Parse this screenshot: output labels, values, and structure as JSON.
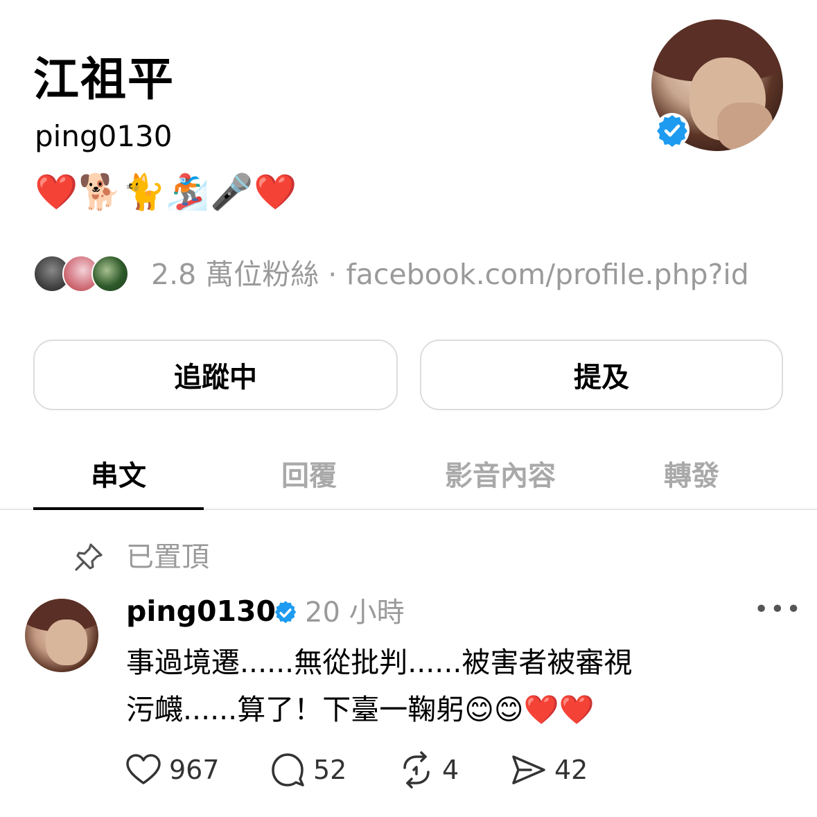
{
  "profile": {
    "display_name": "江祖平",
    "username": "ping0130",
    "bio_emojis": [
      "❤️",
      "🐕",
      "🐈",
      "🏂",
      "🎤",
      "❤️"
    ],
    "followers_text": "2.8 萬位粉絲 · facebook.com/profile.php?id"
  },
  "buttons": {
    "following_label": "追蹤中",
    "mention_label": "提及"
  },
  "tabs": [
    {
      "label": "串文",
      "active": true
    },
    {
      "label": "回覆",
      "active": false
    },
    {
      "label": "影音內容",
      "active": false
    },
    {
      "label": "轉發",
      "active": false
    }
  ],
  "pinned": {
    "label": "已置頂"
  },
  "post": {
    "username": "ping0130",
    "time": "20 小時",
    "more_label": "•••",
    "line1": "事過境遷......無從批判......被害者被審視",
    "line2": "污衊......算了！下臺一鞠躬😊😊❤️❤️",
    "likes": "967",
    "comments": "52",
    "reposts": "4",
    "shares": "42"
  },
  "colors": {
    "verified": "#1d9bf0",
    "muted_text": "#9a9a9a",
    "border": "#dcdcdc"
  }
}
